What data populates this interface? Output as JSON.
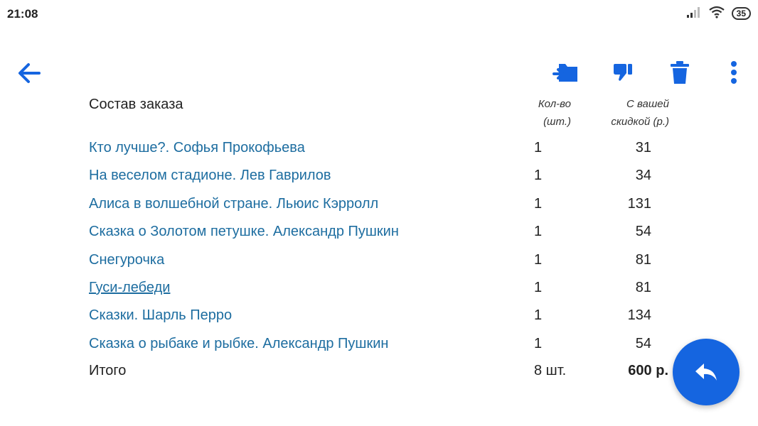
{
  "status_bar": {
    "time": "21:08",
    "battery": "35",
    "icons": [
      "signal-icon",
      "wifi-icon",
      "battery-icon"
    ]
  },
  "toolbar": {
    "icons": [
      "back-arrow-icon",
      "transfer-folder-icon",
      "dislike-icon",
      "trash-icon",
      "more-vert-icon"
    ],
    "accent_color": "#1565e0"
  },
  "order": {
    "title": "Состав заказа",
    "col_qty_line1": "Кол-во",
    "col_qty_line2": "(шт.)",
    "col_price_line1": "С вашей",
    "col_price_line2": "скидкой (р.)",
    "items": [
      {
        "name": "Кто лучше?. Софья Прокофьева",
        "qty": "1",
        "price": "31"
      },
      {
        "name": "На веселом стадионе. Лев Гаврилов",
        "qty": "1",
        "price": "34"
      },
      {
        "name": "Алиса в волшебной стране. Льюис Кэрролл",
        "qty": "1",
        "price": "131"
      },
      {
        "name": "Сказка о Золотом петушке. Александр Пушкин",
        "qty": "1",
        "price": "54"
      },
      {
        "name": "Снегурочка",
        "qty": "1",
        "price": "81"
      },
      {
        "name": "Гуси-лебеди",
        "qty": "1",
        "price": "81"
      },
      {
        "name": "Сказки. Шарль Перро",
        "qty": "1",
        "price": "134"
      },
      {
        "name": "Сказка о рыбаке и рыбке. Александр Пушкин",
        "qty": "1",
        "price": "54"
      }
    ],
    "total_label": "Итого",
    "total_qty": "8 шт.",
    "total_sum": "600 р."
  },
  "fab": {
    "icon": "reply-icon"
  }
}
